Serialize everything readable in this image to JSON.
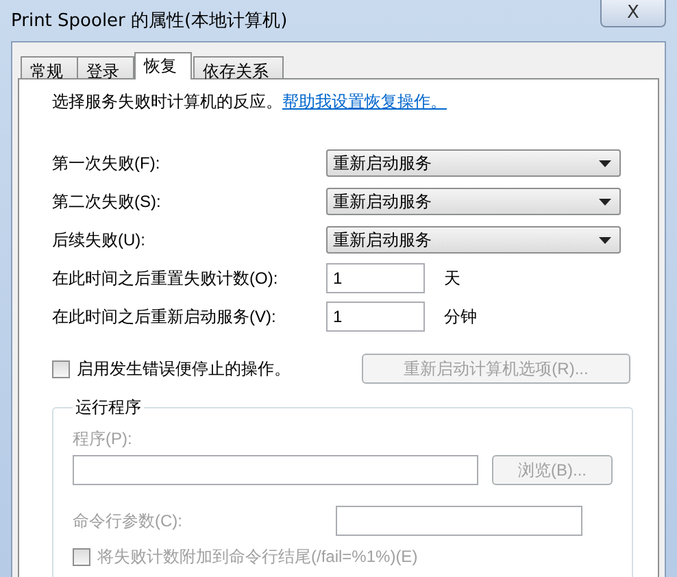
{
  "window": {
    "title": "Print Spooler 的属性(本地计算机)",
    "close": "X"
  },
  "tabs": [
    {
      "label": "常规",
      "selected": false
    },
    {
      "label": "登录",
      "selected": false
    },
    {
      "label": "恢复",
      "selected": true
    },
    {
      "label": "依存关系",
      "selected": false
    }
  ],
  "intro": {
    "text": "选择服务失败时计算机的反应。",
    "link": "帮助我设置恢复操作。"
  },
  "failures": [
    {
      "label": "第一次失败(F):",
      "value": "重新启动服务"
    },
    {
      "label": "第二次失败(S):",
      "value": "重新启动服务"
    },
    {
      "label": "后续失败(U):",
      "value": "重新启动服务"
    }
  ],
  "counters": [
    {
      "label": "在此时间之后重置失败计数(O):",
      "value": "1",
      "unit": "天"
    },
    {
      "label": "在此时间之后重新启动服务(V):",
      "value": "1",
      "unit": "分钟"
    }
  ],
  "stop_actions": {
    "label": "启用发生错误便停止的操作。",
    "checked": false
  },
  "restart_options": {
    "label": "重新启动计算机选项(R)...",
    "disabled": true
  },
  "run_program": {
    "title": "运行程序",
    "disabled": true,
    "program_label": "程序(P):",
    "browse": "浏览(B)...",
    "params_label": "命令行参数(C):",
    "append_fail": {
      "label": "将失败计数附加到命令行结尾(/fail=%1%)(E)",
      "checked": false
    }
  }
}
